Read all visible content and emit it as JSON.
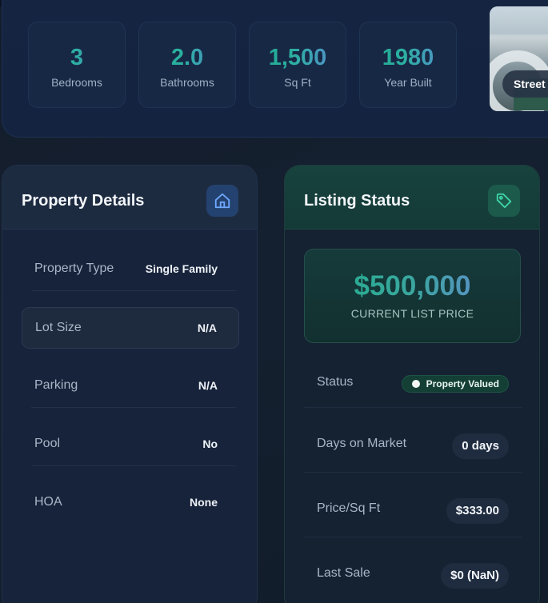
{
  "stats": [
    {
      "value": "3",
      "label": "Bedrooms"
    },
    {
      "value": "2.0",
      "label": "Bathrooms"
    },
    {
      "value": "1,500",
      "label": "Sq Ft"
    },
    {
      "value": "1980",
      "label": "Year Built"
    }
  ],
  "street_view": {
    "label": "Street View"
  },
  "property_details": {
    "title": "Property Details",
    "icon": "home-icon",
    "rows": [
      {
        "key": "Property Type",
        "value": "Single Family"
      },
      {
        "key": "Lot Size",
        "value": "N/A"
      },
      {
        "key": "Parking",
        "value": "N/A"
      },
      {
        "key": "Pool",
        "value": "No"
      },
      {
        "key": "HOA",
        "value": "None"
      }
    ]
  },
  "listing_status": {
    "title": "Listing Status",
    "icon": "tag-icon",
    "price": "$500,000",
    "price_label": "CURRENT LIST PRICE",
    "rows": [
      {
        "key": "Status",
        "value": "Property Valued"
      },
      {
        "key": "Days on Market",
        "value": "0 days"
      },
      {
        "key": "Price/Sq Ft",
        "value": "$333.00"
      },
      {
        "key": "Last Sale",
        "value": "$0 (NaN)"
      }
    ]
  },
  "colors": {
    "accent_teal": "#1fa88d",
    "accent_blue": "#5c86d6",
    "status_bg": "#143f35"
  }
}
